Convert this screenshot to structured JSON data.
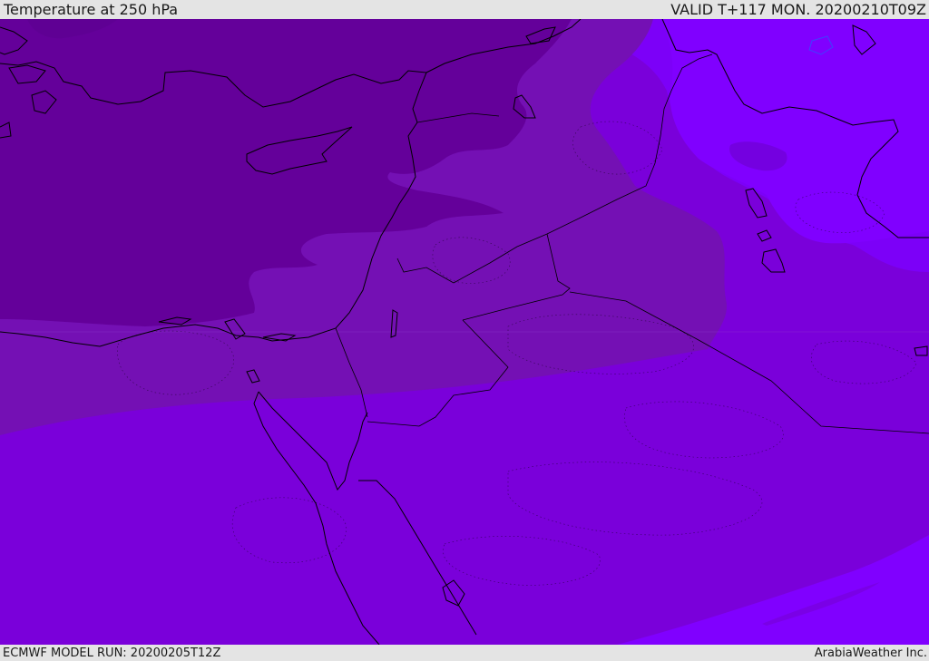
{
  "header": {
    "title": "Temperature at 250 hPa",
    "valid": "VALID T+117 MON. 20200210T09Z"
  },
  "footer": {
    "model_run": "ECMWF MODEL RUN: 20200205T12Z",
    "credit": "ArabiaWeather Inc."
  },
  "colors": {
    "band_coldest": "#64009a",
    "band_cold": "#7410b4",
    "band_mid": "#7a00da",
    "band_warm": "#7c00f8",
    "band_warmest": "#8000ff",
    "coast": "#000000"
  }
}
